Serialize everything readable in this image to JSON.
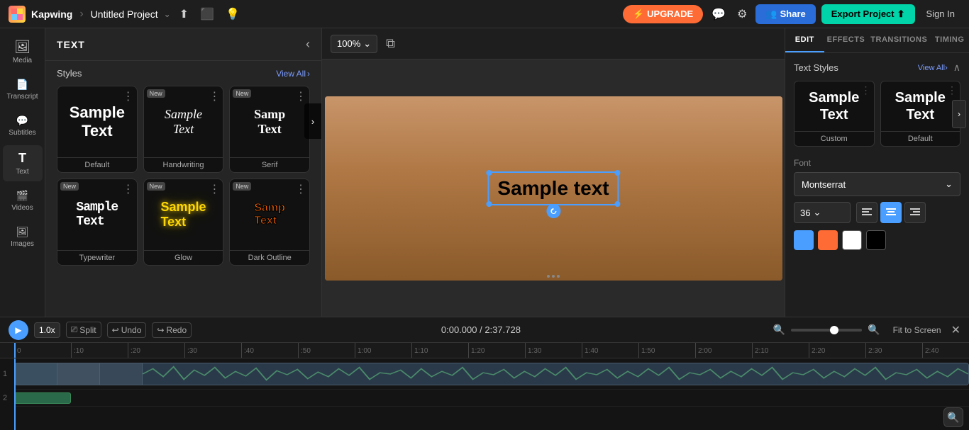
{
  "app": {
    "brand": "Kapwing",
    "project_title": "Untitled Project"
  },
  "topbar": {
    "upgrade_label": "UPGRADE",
    "share_label": "Share",
    "export_label": "Export Project",
    "signin_label": "Sign In"
  },
  "sidebar": {
    "items": [
      {
        "id": "media",
        "label": "Media",
        "icon": "🖼"
      },
      {
        "id": "transcript",
        "label": "Transcript",
        "icon": "📝"
      },
      {
        "id": "subtitles",
        "label": "Subtitles",
        "icon": "💬"
      },
      {
        "id": "text",
        "label": "Text",
        "icon": "T"
      },
      {
        "id": "videos",
        "label": "Videos",
        "icon": "🎬"
      },
      {
        "id": "images",
        "label": "Images",
        "icon": "🖼"
      }
    ]
  },
  "text_panel": {
    "title": "TEXT",
    "styles_label": "Styles",
    "view_all_label": "View All",
    "cards": [
      {
        "id": "default",
        "label": "Default",
        "badge": null,
        "text": "Sample Text"
      },
      {
        "id": "handwriting",
        "label": "Handwriting",
        "badge": "New",
        "text": "Sample Text"
      },
      {
        "id": "serif",
        "label": "Serif",
        "badge": "New",
        "text": "Sample Text"
      },
      {
        "id": "typewriter",
        "label": "Typewriter",
        "badge": "New",
        "text": "Sample Text"
      },
      {
        "id": "glow",
        "label": "Glow",
        "badge": "New",
        "text": "Sample Text"
      },
      {
        "id": "dark-outline",
        "label": "Dark Outline",
        "badge": "New",
        "text": "Sample Text"
      }
    ]
  },
  "canvas": {
    "zoom_label": "100%",
    "sample_text": "Sample text"
  },
  "right_panel": {
    "tabs": [
      {
        "id": "edit",
        "label": "EDIT"
      },
      {
        "id": "effects",
        "label": "EFFECTS"
      },
      {
        "id": "transitions",
        "label": "TRANSITIONS"
      },
      {
        "id": "timing",
        "label": "TIMING"
      }
    ],
    "text_styles_label": "Text Styles",
    "view_all_label": "View All",
    "style_cards": [
      {
        "id": "custom",
        "label": "Custom",
        "text": "Sample Text"
      },
      {
        "id": "default",
        "label": "Default",
        "text": "Sample Text"
      }
    ],
    "font_label": "Font",
    "font_value": "Montserrat",
    "font_size": "36",
    "align_buttons": [
      {
        "id": "left",
        "icon": "≡",
        "active": false
      },
      {
        "id": "center",
        "icon": "≡",
        "active": true
      },
      {
        "id": "right",
        "icon": "≡",
        "active": false
      }
    ]
  },
  "timeline": {
    "play_label": "▶",
    "speed": "1.0x",
    "split_label": "Split",
    "undo_label": "Undo",
    "redo_label": "Redo",
    "time_display": "0:00.000 / 2:37.728",
    "fit_label": "Fit to Screen",
    "ruler_marks": [
      "0",
      ":10",
      ":20",
      ":30",
      ":40",
      ":50",
      "1:00",
      "1:10",
      "1:20",
      "1:30",
      "1:40",
      "1:50",
      "2:00",
      "2:10",
      "2:20",
      "2:30",
      "2:40"
    ],
    "tracks": [
      {
        "number": "1",
        "type": "video"
      },
      {
        "number": "2",
        "type": "text"
      }
    ]
  }
}
